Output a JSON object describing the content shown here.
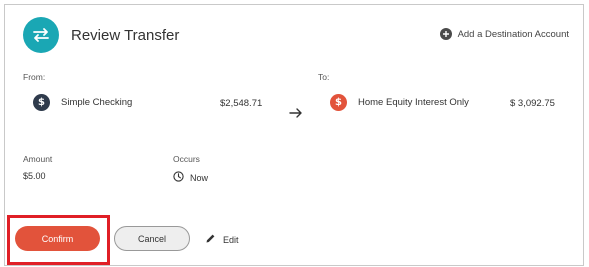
{
  "header": {
    "title": "Review Transfer",
    "add_destination_label": "Add a Destination Account",
    "accent_color": "#1aa7b4"
  },
  "from": {
    "label": "From:",
    "account_name": "Simple Checking",
    "balance": "$2,548.71",
    "icon": "dollar-icon",
    "icon_color": "#2f3b4c"
  },
  "to": {
    "label": "To:",
    "account_name": "Home Equity Interest Only",
    "balance": "$ 3,092.75",
    "icon": "dollar-icon",
    "icon_color": "#e2533b"
  },
  "amount": {
    "label": "Amount",
    "value": "$5.00"
  },
  "occurs": {
    "label": "Occurs",
    "value": "Now",
    "icon": "clock-icon"
  },
  "actions": {
    "confirm_label": "Confirm",
    "cancel_label": "Cancel",
    "edit_label": "Edit",
    "confirm_color": "#e2533b",
    "highlight_color": "#e01f26"
  }
}
